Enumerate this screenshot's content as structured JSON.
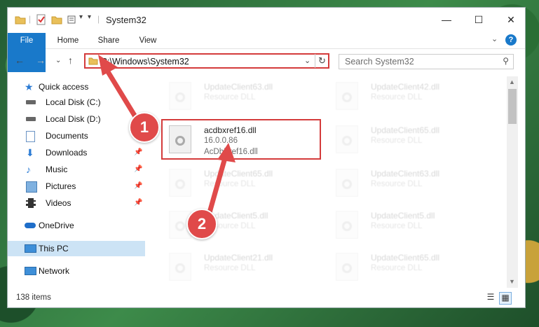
{
  "window": {
    "title": "System32"
  },
  "ribbon": {
    "tabs": [
      "File",
      "Home",
      "Share",
      "View"
    ]
  },
  "address": {
    "path": "C:\\Windows\\System32"
  },
  "search": {
    "placeholder": "Search System32"
  },
  "sidebar": {
    "items": [
      {
        "label": "Quick access",
        "icon": "star-icon",
        "pinned": false
      },
      {
        "label": "Local Disk (C:)",
        "icon": "disk-icon",
        "pinned": false
      },
      {
        "label": "Local Disk (D:)",
        "icon": "disk-icon",
        "pinned": false
      },
      {
        "label": "Documents",
        "icon": "documents-icon",
        "pinned": true
      },
      {
        "label": "Downloads",
        "icon": "downloads-icon",
        "pinned": true
      },
      {
        "label": "Music",
        "icon": "music-icon",
        "pinned": true
      },
      {
        "label": "Pictures",
        "icon": "pictures-icon",
        "pinned": true
      },
      {
        "label": "Videos",
        "icon": "videos-icon",
        "pinned": true
      },
      {
        "label": "OneDrive",
        "icon": "cloud-icon",
        "pinned": false
      },
      {
        "label": "This PC",
        "icon": "pc-icon",
        "pinned": false,
        "selected": true
      },
      {
        "label": "Network",
        "icon": "network-icon",
        "pinned": false
      }
    ]
  },
  "files": [
    {
      "name": "UpdateClient63.dll",
      "type": "Resource DLL",
      "faded": true
    },
    {
      "name": "UpdateClient42.dll",
      "type": "Resource DLL",
      "faded": true
    },
    {
      "name": "acdbxref16.dll",
      "version": "16.0.0.86",
      "description": "AcDbXref16.dll",
      "faded": false
    },
    {
      "name": "UpdateClient65.dll",
      "type": "Resource DLL",
      "faded": true
    },
    {
      "name": "UpdateClient65.dll",
      "type": "Resource DLL",
      "faded": true
    },
    {
      "name": "UpdateClient63.dll",
      "type": "Resource DLL",
      "faded": true
    },
    {
      "name": "UpdateClient5.dll",
      "type": "Resource DLL",
      "faded": true
    },
    {
      "name": "UpdateClient5.dll",
      "type": "Resource DLL",
      "faded": true
    },
    {
      "name": "UpdateClient21.dll",
      "type": "Resource DLL",
      "faded": true
    },
    {
      "name": "UpdateClient65.dll",
      "type": "Resource DLL",
      "faded": true
    }
  ],
  "status": {
    "count": "138 items"
  },
  "callouts": {
    "one": "1",
    "two": "2"
  },
  "colors": {
    "accent": "#1979ca",
    "highlight": "#d43b3b",
    "selection": "#cce3f5"
  }
}
